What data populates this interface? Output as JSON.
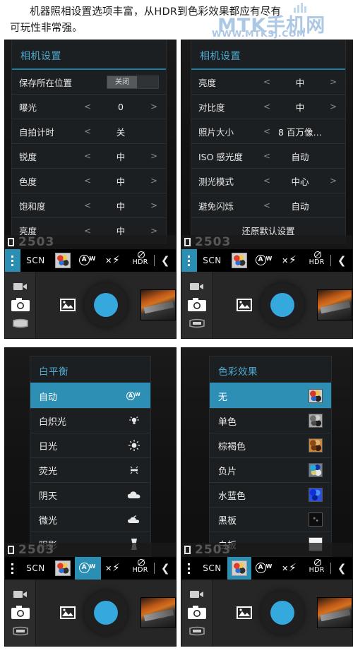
{
  "caption": {
    "line1": "机器照相设置选项丰富，从HDR到色彩效果都应有尽有",
    "line2": "可玩性非常强。"
  },
  "watermark": {
    "main": "MTK手机网",
    "sub": "WWW.MTKSJ.COM"
  },
  "shots": [
    {
      "id": "camera-settings-page1",
      "panel_title": "相机设置",
      "rows": [
        {
          "label": "保存所在位置",
          "type": "switch",
          "value": "关闭"
        },
        {
          "label": "曝光",
          "type": "stepper",
          "value": "0",
          "left": "<",
          "right": ">"
        },
        {
          "label": "自拍计时",
          "type": "stepper",
          "value": "关",
          "left": "<",
          "right": ""
        },
        {
          "label": "锐度",
          "type": "stepper",
          "value": "中",
          "left": "<",
          "right": ">"
        },
        {
          "label": "色度",
          "type": "stepper",
          "value": "中",
          "left": "<",
          "right": ">"
        },
        {
          "label": "饱和度",
          "type": "stepper",
          "value": "中",
          "left": "<",
          "right": ">"
        },
        {
          "label": "亮度",
          "type": "stepper",
          "value": "中",
          "left": "<",
          "right": ">"
        }
      ],
      "watermark_num": "2503",
      "toolbar": {
        "scn": "SCN",
        "aw": "AW",
        "hdr": "HDR",
        "chevron": "❮",
        "highlight": "menu"
      }
    },
    {
      "id": "camera-settings-page2",
      "panel_title": "相机设置",
      "rows": [
        {
          "label": "亮度",
          "type": "stepper",
          "value": "中",
          "left": "<",
          "right": ">"
        },
        {
          "label": "对比度",
          "type": "stepper",
          "value": "中",
          "left": "<",
          "right": ">"
        },
        {
          "label": "照片大小",
          "type": "stepper",
          "value": "8 百万像…",
          "left": "<",
          "right": ""
        },
        {
          "label": "ISO 感光度",
          "type": "stepper",
          "value": "自动",
          "left": "<",
          "right": ""
        },
        {
          "label": "测光模式",
          "type": "stepper",
          "value": "中心",
          "left": "<",
          "right": ">"
        },
        {
          "label": "避免闪烁",
          "type": "stepper",
          "value": "自动",
          "left": "<",
          "right": ""
        },
        {
          "label": "还原默认设置",
          "type": "action",
          "value": ""
        }
      ],
      "watermark_num": "2503",
      "toolbar": {
        "scn": "SCN",
        "aw": "AW",
        "hdr": "HDR",
        "chevron": "❮",
        "highlight": "menu"
      }
    },
    {
      "id": "white-balance-page",
      "panel_title": "白平衡",
      "items": [
        {
          "label": "自动",
          "icon": "auto-wb-icon",
          "selected": true
        },
        {
          "label": "白炽光",
          "icon": "incandescent-icon",
          "selected": false
        },
        {
          "label": "日光",
          "icon": "daylight-icon",
          "selected": false
        },
        {
          "label": "荧光",
          "icon": "fluorescent-icon",
          "selected": false
        },
        {
          "label": "阴天",
          "icon": "cloudy-icon",
          "selected": false
        },
        {
          "label": "微光",
          "icon": "twilight-icon",
          "selected": false
        },
        {
          "label": "阴影",
          "icon": "shade-icon",
          "selected": false
        }
      ],
      "watermark_num": "2503",
      "toolbar": {
        "scn": "SCN",
        "aw": "AW",
        "hdr": "HDR",
        "chevron": "❮",
        "highlight": "aw"
      }
    },
    {
      "id": "color-effect-page",
      "panel_title": "色彩效果",
      "items": [
        {
          "label": "无",
          "thumb": "none-thumb",
          "selected": true
        },
        {
          "label": "单色",
          "thumb": "mono-thumb",
          "selected": false
        },
        {
          "label": "棕褐色",
          "thumb": "sepia-thumb",
          "selected": false
        },
        {
          "label": "负片",
          "thumb": "negative-thumb",
          "selected": false
        },
        {
          "label": "水蓝色",
          "thumb": "aqua-thumb",
          "selected": false
        },
        {
          "label": "黑板",
          "thumb": "blackboard-thumb",
          "selected": false
        },
        {
          "label": "白板",
          "thumb": "whiteboard-thumb",
          "selected": false
        }
      ],
      "watermark_num": "2503",
      "toolbar": {
        "scn": "SCN",
        "aw": "AW",
        "hdr": "HDR",
        "chevron": "❮",
        "highlight": "effect"
      }
    }
  ],
  "capture_bar": {
    "modes": [
      "video-mode-icon",
      "photo-mode-icon",
      "panorama-mode-icon"
    ],
    "gallery": "gallery-icon",
    "shutter": "shutter-button",
    "thumbnail": "last-photo-thumbnail"
  },
  "colors": {
    "accent": "#2e8fb4",
    "title": "#4ea9cf",
    "shutter": "#35a8dd",
    "panel_bg": "#1c1f21",
    "toolbar_bg": "#000000"
  }
}
